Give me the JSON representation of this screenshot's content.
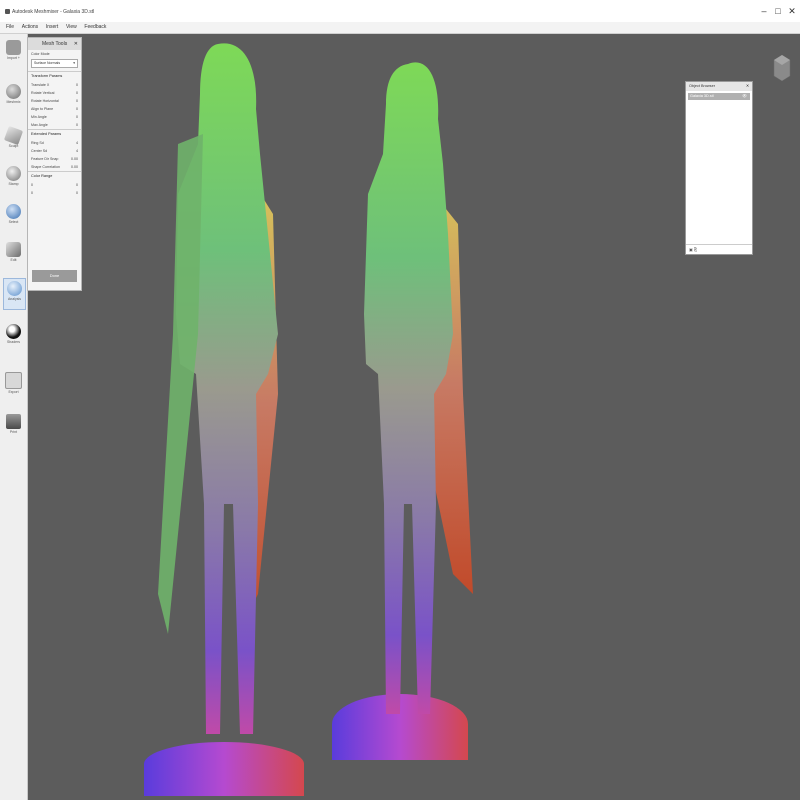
{
  "window": {
    "title": "Autodesk Meshmixer - Galaxia 3D.stl",
    "minimize_glyph": "–",
    "maximize_glyph": "□",
    "close_glyph": "✕"
  },
  "menu": [
    "File",
    "Actions",
    "Insert",
    "View",
    "Feedback"
  ],
  "sidebar": {
    "tools": [
      {
        "label": "Import +",
        "icon": "import-icon",
        "color": "#9a9a9a"
      },
      {
        "label": "Meshmix",
        "icon": "meshmix-icon",
        "color": "#8a8a8a"
      },
      {
        "label": "Sculpt",
        "icon": "sculpt-icon",
        "color": "#a0a0a0"
      },
      {
        "label": "Stamp",
        "icon": "stamp-icon",
        "color": "#888888"
      },
      {
        "label": "Select",
        "icon": "select-icon",
        "color": "#4a7fc0"
      },
      {
        "label": "Edit",
        "icon": "edit-icon",
        "color": "#8c8c8c"
      },
      {
        "label": "Analysis",
        "icon": "analysis-icon",
        "color": "#6f9fd0"
      },
      {
        "label": "Shaders",
        "icon": "shaders-icon",
        "color": "#2b2b2b"
      },
      {
        "label": "Export",
        "icon": "export-icon",
        "color": "#b0b0b0"
      },
      {
        "label": "Print",
        "icon": "print-icon",
        "color": "#6f6f6f"
      }
    ]
  },
  "panel": {
    "title": "Mesh Tools",
    "close": "✕",
    "color_mode_label": "Color Mode",
    "color_mode_value": "Surface Normals",
    "sections": [
      {
        "name": "Transform Params",
        "rows": [
          {
            "label": "Translate X",
            "value": "0"
          },
          {
            "label": "Rotate Vertical",
            "value": "0"
          },
          {
            "label": "Rotate Horizontal",
            "value": "0"
          },
          {
            "label": "Align to Plane",
            "value": "0"
          },
          {
            "label": "Min Angle",
            "value": "0"
          },
          {
            "label": "Max Angle",
            "value": "0"
          }
        ]
      },
      {
        "name": "Extended Params",
        "rows": [
          {
            "label": "Ring Sd",
            "value": "4"
          },
          {
            "label": "Center Sd",
            "value": "4"
          },
          {
            "label": "Feature Dir Snap",
            "value": "0.00"
          },
          {
            "label": "Shape Correlation",
            "value": "0.00"
          }
        ]
      },
      {
        "name": "Color Range",
        "rows": [
          {
            "label": "0",
            "value": "0"
          },
          {
            "label": "0",
            "value": "0"
          }
        ]
      }
    ],
    "done_button": "Done"
  },
  "object_browser": {
    "title": "Object Browser",
    "close": "✕",
    "items": [
      {
        "name": "Galaxia 3D.stl",
        "eye": "👁"
      }
    ],
    "footer": "▣ ⎘"
  },
  "colors": {
    "viewport_bg": "#5c5c5c",
    "panel_bg": "#f4f4f4",
    "sidebar_bg": "#efefef"
  }
}
